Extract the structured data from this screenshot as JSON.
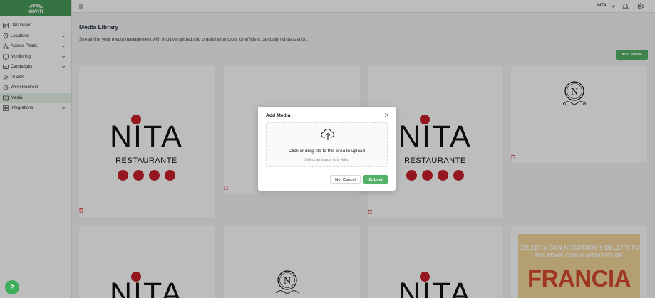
{
  "brand": {
    "logo_text": "aiwifi",
    "color": "#4a9b5a"
  },
  "sidebar": {
    "items": [
      {
        "label": "Dashboard",
        "icon": "dashboard-icon",
        "has_children": false,
        "active": false
      },
      {
        "label": "Locations",
        "icon": "location-pin-icon",
        "has_children": true,
        "active": false
      },
      {
        "label": "Access Points",
        "icon": "network-icon",
        "has_children": true,
        "active": false
      },
      {
        "label": "Monitoring",
        "icon": "monitor-icon",
        "has_children": true,
        "active": false
      },
      {
        "label": "Campaigns",
        "icon": "campaign-icon",
        "has_children": true,
        "active": false
      },
      {
        "label": "Guests",
        "icon": "guests-icon",
        "has_children": false,
        "active": false
      },
      {
        "label": "Wi-Fi Redirect",
        "icon": "redirect-icon",
        "has_children": false,
        "active": false
      },
      {
        "label": "Media",
        "icon": "media-icon",
        "has_children": false,
        "active": true
      },
      {
        "label": "Integrations",
        "icon": "integrations-icon",
        "has_children": true,
        "active": false
      }
    ]
  },
  "topbar": {
    "user_name": "NITA"
  },
  "page": {
    "title": "Media Library",
    "subtitle": "Streamline your media management with intuitive upload and organization tools for efficient campaign visualization.",
    "add_button": "Add Media"
  },
  "media_items": {
    "nita_title": "NITA",
    "nita_subtitle": "RESTAURANTE",
    "poster_line_1": "CELEBRA CON NOSOTROS  Y DELEITA TU",
    "poster_line_2": "PALADAR CON MANJARES DE",
    "poster_big": "FRANCIA"
  },
  "modal": {
    "title": "Add Media",
    "drop_text": "Click or drag file to this area to upload",
    "drop_hint": "Select an image or a video",
    "cancel_label": "No, Cancel",
    "submit_label": "Submit"
  },
  "help": {
    "label": "?"
  },
  "colors": {
    "accent": "#52b266",
    "danger": "#c8202a"
  }
}
